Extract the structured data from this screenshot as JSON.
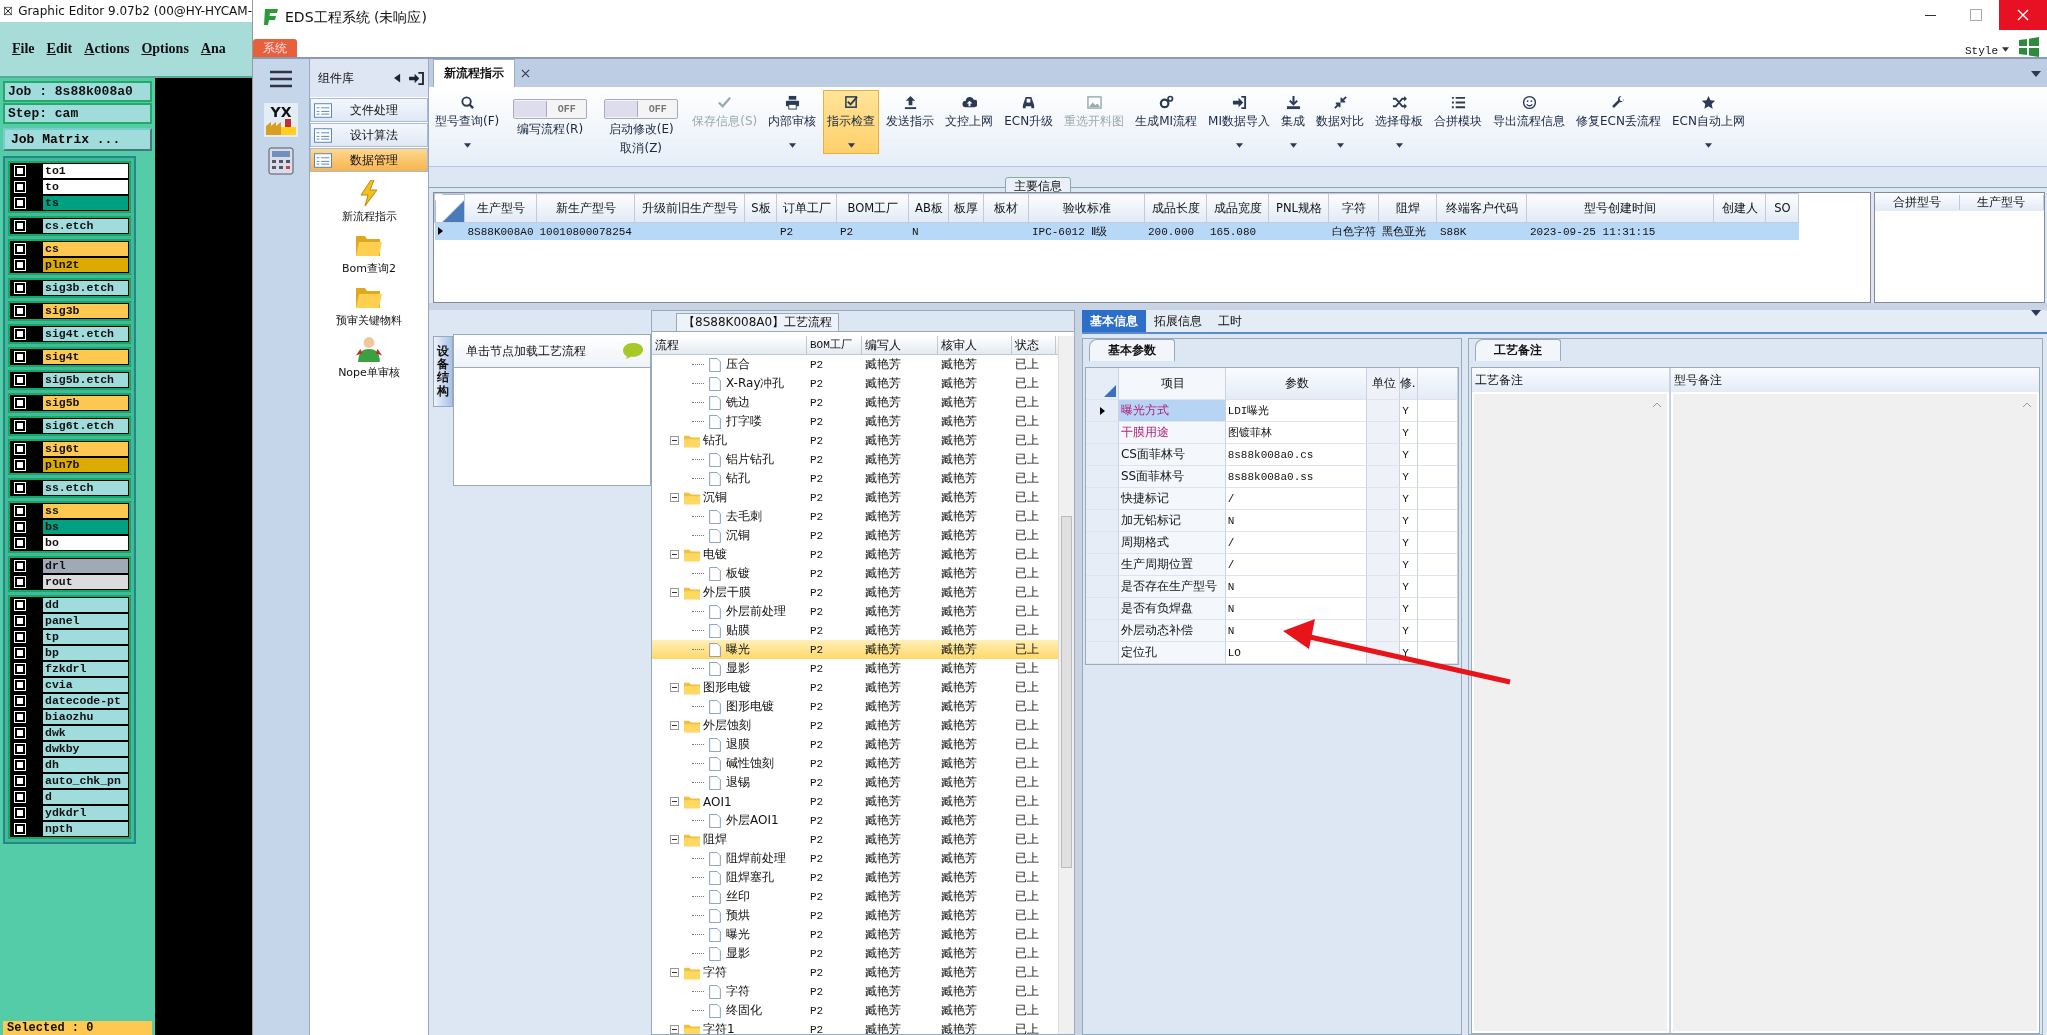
{
  "graphic_editor": {
    "title": "Graphic Editor 9.07b2 (00@HY-HYCAM-",
    "menu": [
      "File",
      "Edit",
      "Actions",
      "Options",
      "Ana"
    ],
    "job": "Job : 8s88k008a0",
    "step": "Step: cam",
    "matrix_button": "Job Matrix ...",
    "layer_groups": [
      [
        {
          "name": "to1",
          "color": "#ffffff",
          "checked": false
        },
        {
          "name": "to",
          "color": "#ffffff",
          "checked": false
        },
        {
          "name": "ts",
          "color": "#00a080",
          "checked": false
        }
      ],
      [
        {
          "name": "cs.etch",
          "color": "#a0dcdc",
          "checked": false
        }
      ],
      [
        {
          "name": "cs",
          "color": "#ffc850",
          "checked": false
        },
        {
          "name": "pln2t",
          "color": "#dcaa00",
          "checked": false
        }
      ],
      [
        {
          "name": "sig3b.etch",
          "color": "#a0dcdc",
          "checked": false
        }
      ],
      [
        {
          "name": "sig3b",
          "color": "#ffc850",
          "checked": false
        }
      ],
      [
        {
          "name": "sig4t.etch",
          "color": "#a0dcdc",
          "checked": false
        }
      ],
      [
        {
          "name": "sig4t",
          "color": "#ffc850",
          "checked": false
        }
      ],
      [
        {
          "name": "sig5b.etch",
          "color": "#a0dcdc",
          "checked": false
        }
      ],
      [
        {
          "name": "sig5b",
          "color": "#ffc850",
          "checked": false
        }
      ],
      [
        {
          "name": "sig6t.etch",
          "color": "#a0dcdc",
          "checked": false
        }
      ],
      [
        {
          "name": "sig6t",
          "color": "#ffc850",
          "checked": false
        },
        {
          "name": "pln7b",
          "color": "#dcaa00",
          "checked": false
        }
      ],
      [
        {
          "name": "ss.etch",
          "color": "#a0dcdc",
          "checked": false
        }
      ],
      [
        {
          "name": "ss",
          "color": "#ffc850",
          "checked": false
        },
        {
          "name": "bs",
          "color": "#00a080",
          "checked": false
        },
        {
          "name": "bo",
          "color": "#ffffff",
          "checked": false
        }
      ],
      [
        {
          "name": "drl",
          "color": "#a0aab4",
          "checked": false
        },
        {
          "name": "rout",
          "color": "#dcdcdc",
          "checked": false
        }
      ],
      [
        {
          "name": "dd",
          "color": "#a0dcdc",
          "checked": false
        },
        {
          "name": "panel",
          "color": "#a0dcdc",
          "checked": false
        },
        {
          "name": "tp",
          "color": "#a0dcdc",
          "checked": false
        },
        {
          "name": "bp",
          "color": "#a0dcdc",
          "checked": false
        },
        {
          "name": "fzkdrl",
          "color": "#a0dcdc",
          "checked": false
        },
        {
          "name": "cvia",
          "color": "#a0dcdc",
          "checked": false
        },
        {
          "name": "datecode-pt",
          "color": "#a0dcdc",
          "checked": false
        },
        {
          "name": "biaozhu",
          "color": "#a0dcdc",
          "checked": false
        },
        {
          "name": "dwk",
          "color": "#a0dcdc",
          "checked": false
        },
        {
          "name": "dwkby",
          "color": "#a0dcdc",
          "checked": false
        },
        {
          "name": "dh",
          "color": "#a0dcdc",
          "checked": false
        },
        {
          "name": "auto_chk_pn",
          "color": "#a0dcdc",
          "checked": false
        },
        {
          "name": "d",
          "color": "#a0dcdc",
          "checked": false
        },
        {
          "name": "ydkdrl",
          "color": "#a0dcdc",
          "checked": false
        },
        {
          "name": "npth",
          "color": "#a0dcdc",
          "checked": false
        }
      ]
    ],
    "status": "Selected : 0"
  },
  "eds": {
    "title": "EDS工程系统 (未响应)",
    "ribbon_tab": "系统",
    "style_menu": "Style",
    "nav_logo_text": "YX",
    "component_library": {
      "title": "组件库",
      "items": [
        {
          "label": "文件处理",
          "selected": false
        },
        {
          "label": "设计算法",
          "selected": false
        },
        {
          "label": "数据管理",
          "selected": true
        }
      ],
      "tools": [
        "新流程指示",
        "Bom查询2",
        "预审关键物料",
        "Nope单审核"
      ]
    },
    "document_tab": "新流程指示",
    "toolbar": [
      {
        "kind": "button",
        "label": "型号查询(F)",
        "dropdown": true,
        "disabled": false,
        "selected": false
      },
      {
        "kind": "toggle",
        "label": "编写流程(R)",
        "switch_text": "OFF",
        "on": false
      },
      {
        "kind": "toggle",
        "label": "启动修改(E)",
        "label2": "取消(Z)",
        "switch_text": "OFF",
        "on": false
      },
      {
        "kind": "button",
        "label": "保存信息(S)",
        "dropdown": false,
        "disabled": true,
        "selected": false
      },
      {
        "kind": "button",
        "label": "内部审核",
        "dropdown": true,
        "disabled": false,
        "selected": false
      },
      {
        "kind": "button",
        "label": "指示检查",
        "dropdown": true,
        "disabled": false,
        "selected": true
      },
      {
        "kind": "button",
        "label": "发送指示",
        "dropdown": false,
        "disabled": false,
        "selected": false
      },
      {
        "kind": "button",
        "label": "文控上网",
        "dropdown": false,
        "disabled": false,
        "selected": false
      },
      {
        "kind": "button",
        "label": "ECN升级",
        "dropdown": false,
        "disabled": false,
        "selected": false
      },
      {
        "kind": "button",
        "label": "重选开料图",
        "dropdown": false,
        "disabled": true,
        "selected": false
      },
      {
        "kind": "button",
        "label": "生成MI流程",
        "dropdown": false,
        "disabled": false,
        "selected": false
      },
      {
        "kind": "button",
        "label": "MI数据导入",
        "dropdown": true,
        "disabled": false,
        "selected": false
      },
      {
        "kind": "button",
        "label": "集成",
        "dropdown": true,
        "disabled": false,
        "selected": false
      },
      {
        "kind": "button",
        "label": "数据对比",
        "dropdown": true,
        "disabled": false,
        "selected": false
      },
      {
        "kind": "button",
        "label": "选择母板",
        "dropdown": true,
        "disabled": false,
        "selected": false
      },
      {
        "kind": "button",
        "label": "合拼模块",
        "dropdown": false,
        "disabled": false,
        "selected": false
      },
      {
        "kind": "button",
        "label": "导出流程信息",
        "dropdown": false,
        "disabled": false,
        "selected": false
      },
      {
        "kind": "button",
        "label": "修复ECN丢流程",
        "dropdown": false,
        "disabled": false,
        "selected": false
      },
      {
        "kind": "button",
        "label": "ECN自动上网",
        "dropdown": true,
        "disabled": false,
        "selected": false
      }
    ],
    "main_info": {
      "title": "主要信息",
      "columns": [
        "生产型号",
        "新生产型号",
        "升级前旧生产型号",
        "S板",
        "订单工厂",
        "BOM工厂",
        "AB板",
        "板厚",
        "板材",
        "验收标准",
        "成品长度",
        "成品宽度",
        "PNL规格",
        "字符",
        "阻焊",
        "终端客户代码",
        "型号创建时间",
        "创建人",
        "SO"
      ],
      "rows": [
        {
          "selected": true,
          "cells": [
            "8S88K008A0",
            "10010800078254",
            null,
            null,
            "P2",
            "P2",
            "N",
            null,
            null,
            "IPC-6012 Ⅱ级",
            "200.000",
            "165.080",
            null,
            "白色字符",
            "黑色亚光",
            "S88K",
            "2023-09-25 11:31:15",
            null,
            null
          ]
        }
      ],
      "side_columns": [
        "合拼型号",
        "生产型号"
      ]
    },
    "side_tab": "设备结构",
    "flow_hint": "单击节点加载工艺流程",
    "tree": {
      "title": "【8S88K008A0】工艺流程",
      "columns": [
        "流程",
        "BOM工厂",
        "编写人",
        "核审人",
        "状态"
      ],
      "nodes": [
        {
          "kind": "continuation",
          "children": [
            {
              "kind": "file",
              "name": "压合",
              "bom": "P2",
              "writer": "臧艳芳",
              "checker": "臧艳芳",
              "status": "已上",
              "selected": false
            },
            {
              "kind": "file",
              "name": "X-Ray冲孔",
              "bom": "P2",
              "writer": "臧艳芳",
              "checker": "臧艳芳",
              "status": "已上",
              "selected": false
            },
            {
              "kind": "file",
              "name": "铣边",
              "bom": "P2",
              "writer": "臧艳芳",
              "checker": "臧艳芳",
              "status": "已上",
              "selected": false
            },
            {
              "kind": "file",
              "name": "打字喽",
              "bom": "P2",
              "writer": "臧艳芳",
              "checker": "臧艳芳",
              "status": "已上",
              "selected": false
            }
          ]
        },
        {
          "kind": "folder",
          "name": "钻孔",
          "bom": "P2",
          "writer": "臧艳芳",
          "checker": "臧艳芳",
          "status": "已上",
          "selected": false,
          "expanded": true,
          "children": [
            {
              "kind": "file",
              "name": "铝片钻孔",
              "bom": "P2",
              "writer": "臧艳芳",
              "checker": "臧艳芳",
              "status": "已上",
              "selected": false
            },
            {
              "kind": "file",
              "name": "钻孔",
              "bom": "P2",
              "writer": "臧艳芳",
              "checker": "臧艳芳",
              "status": "已上",
              "selected": false
            }
          ]
        },
        {
          "kind": "folder",
          "name": "沉铜",
          "bom": "P2",
          "writer": "臧艳芳",
          "checker": "臧艳芳",
          "status": "已上",
          "selected": false,
          "expanded": true,
          "children": [
            {
              "kind": "file",
              "name": "去毛刺",
              "bom": "P2",
              "writer": "臧艳芳",
              "checker": "臧艳芳",
              "status": "已上",
              "selected": false
            },
            {
              "kind": "file",
              "name": "沉铜",
              "bom": "P2",
              "writer": "臧艳芳",
              "checker": "臧艳芳",
              "status": "已上",
              "selected": false
            }
          ]
        },
        {
          "kind": "folder",
          "name": "电镀",
          "bom": "P2",
          "writer": "臧艳芳",
          "checker": "臧艳芳",
          "status": "已上",
          "selected": false,
          "expanded": true,
          "children": [
            {
              "kind": "file",
              "name": "板镀",
              "bom": "P2",
              "writer": "臧艳芳",
              "checker": "臧艳芳",
              "status": "已上",
              "selected": false
            }
          ]
        },
        {
          "kind": "folder",
          "name": "外层干膜",
          "bom": "P2",
          "writer": "臧艳芳",
          "checker": "臧艳芳",
          "status": "已上",
          "selected": false,
          "expanded": true,
          "children": [
            {
              "kind": "file",
              "name": "外层前处理",
              "bom": "P2",
              "writer": "臧艳芳",
              "checker": "臧艳芳",
              "status": "已上",
              "selected": false
            },
            {
              "kind": "file",
              "name": "贴膜",
              "bom": "P2",
              "writer": "臧艳芳",
              "checker": "臧艳芳",
              "status": "已上",
              "selected": false
            },
            {
              "kind": "file",
              "name": "曝光",
              "bom": "P2",
              "writer": "臧艳芳",
              "checker": "臧艳芳",
              "status": "已上",
              "selected": true
            },
            {
              "kind": "file",
              "name": "显影",
              "bom": "P2",
              "writer": "臧艳芳",
              "checker": "臧艳芳",
              "status": "已上",
              "selected": false
            }
          ]
        },
        {
          "kind": "folder",
          "name": "图形电镀",
          "bom": "P2",
          "writer": "臧艳芳",
          "checker": "臧艳芳",
          "status": "已上",
          "selected": false,
          "expanded": true,
          "children": [
            {
              "kind": "file",
              "name": "图形电镀",
              "bom": "P2",
              "writer": "臧艳芳",
              "checker": "臧艳芳",
              "status": "已上",
              "selected": false
            }
          ]
        },
        {
          "kind": "folder",
          "name": "外层蚀刻",
          "bom": "P2",
          "writer": "臧艳芳",
          "checker": "臧艳芳",
          "status": "已上",
          "selected": false,
          "expanded": true,
          "children": [
            {
              "kind": "file",
              "name": "退膜",
              "bom": "P2",
              "writer": "臧艳芳",
              "checker": "臧艳芳",
              "status": "已上",
              "selected": false
            },
            {
              "kind": "file",
              "name": "碱性蚀刻",
              "bom": "P2",
              "writer": "臧艳芳",
              "checker": "臧艳芳",
              "status": "已上",
              "selected": false
            },
            {
              "kind": "file",
              "name": "退锡",
              "bom": "P2",
              "writer": "臧艳芳",
              "checker": "臧艳芳",
              "status": "已上",
              "selected": false
            }
          ]
        },
        {
          "kind": "folder",
          "name": "AOI1",
          "bom": "P2",
          "writer": "臧艳芳",
          "checker": "臧艳芳",
          "status": "已上",
          "selected": false,
          "expanded": true,
          "children": [
            {
              "kind": "file",
              "name": "外层AOI1",
              "bom": "P2",
              "writer": "臧艳芳",
              "checker": "臧艳芳",
              "status": "已上",
              "selected": false
            }
          ]
        },
        {
          "kind": "folder",
          "name": "阻焊",
          "bom": "P2",
          "writer": "臧艳芳",
          "checker": "臧艳芳",
          "status": "已上",
          "selected": false,
          "expanded": true,
          "children": [
            {
              "kind": "file",
              "name": "阻焊前处理",
              "bom": "P2",
              "writer": "臧艳芳",
              "checker": "臧艳芳",
              "status": "已上",
              "selected": false
            },
            {
              "kind": "file",
              "name": "阻焊塞孔",
              "bom": "P2",
              "writer": "臧艳芳",
              "checker": "臧艳芳",
              "status": "已上",
              "selected": false
            },
            {
              "kind": "file",
              "name": "丝印",
              "bom": "P2",
              "writer": "臧艳芳",
              "checker": "臧艳芳",
              "status": "已上",
              "selected": false
            },
            {
              "kind": "file",
              "name": "预烘",
              "bom": "P2",
              "writer": "臧艳芳",
              "checker": "臧艳芳",
              "status": "已上",
              "selected": false
            },
            {
              "kind": "file",
              "name": "曝光",
              "bom": "P2",
              "writer": "臧艳芳",
              "checker": "臧艳芳",
              "status": "已上",
              "selected": false
            },
            {
              "kind": "file",
              "name": "显影",
              "bom": "P2",
              "writer": "臧艳芳",
              "checker": "臧艳芳",
              "status": "已上",
              "selected": false
            }
          ]
        },
        {
          "kind": "folder",
          "name": "字符",
          "bom": "P2",
          "writer": "臧艳芳",
          "checker": "臧艳芳",
          "status": "已上",
          "selected": false,
          "expanded": true,
          "children": [
            {
              "kind": "file",
              "name": "字符",
              "bom": "P2",
              "writer": "臧艳芳",
              "checker": "臧艳芳",
              "status": "已上",
              "selected": false
            },
            {
              "kind": "file",
              "name": "终固化",
              "bom": "P2",
              "writer": "臧艳芳",
              "checker": "臧艳芳",
              "status": "已上",
              "selected": false
            }
          ]
        },
        {
          "kind": "folder",
          "name": "字符1",
          "bom": "P2",
          "writer": "臧艳芳",
          "checker": "臧艳芳",
          "status": "已上",
          "selected": false,
          "expanded": true
        }
      ]
    },
    "info_tabs": [
      {
        "label": "基本信息",
        "selected": true
      },
      {
        "label": "拓展信息",
        "selected": false
      },
      {
        "label": "工时",
        "selected": false
      }
    ],
    "params": {
      "tab": "基本参数",
      "columns": [
        "项目",
        "参数",
        "单位",
        "修.."
      ],
      "rows": [
        {
          "item": "曝光方式",
          "value": "LDI曝光",
          "flag": "Y",
          "highlight": true,
          "selected": true
        },
        {
          "item": "干膜用途",
          "value": "图镀菲林",
          "flag": "Y",
          "highlight": true,
          "selected": false
        },
        {
          "item": "CS面菲林号",
          "value": "8s88k008a0.cs",
          "flag": "Y",
          "highlight": false,
          "selected": false
        },
        {
          "item": "SS面菲林号",
          "value": "8s88k008a0.ss",
          "flag": "Y",
          "highlight": false,
          "selected": false
        },
        {
          "item": "快捷标记",
          "value": "/",
          "flag": "Y",
          "highlight": false,
          "selected": false
        },
        {
          "item": "加无铅标记",
          "value": "N",
          "flag": "Y",
          "highlight": false,
          "selected": false
        },
        {
          "item": "周期格式",
          "value": "/",
          "flag": "Y",
          "highlight": false,
          "selected": false
        },
        {
          "item": "生产周期位置",
          "value": "/",
          "flag": "Y",
          "highlight": false,
          "selected": false
        },
        {
          "item": "是否存在生产型号",
          "value": "N",
          "flag": "Y",
          "highlight": false,
          "selected": false
        },
        {
          "item": "是否有负焊盘",
          "value": "N",
          "flag": "Y",
          "highlight": false,
          "selected": false
        },
        {
          "item": "外层动态补偿",
          "value": "N",
          "flag": "Y",
          "highlight": false,
          "selected": false
        },
        {
          "item": "定位孔",
          "value": "LO",
          "flag": "Y",
          "highlight": false,
          "selected": false
        }
      ]
    },
    "notes": {
      "tab": "工艺备注",
      "columns": [
        "工艺备注",
        "型号备注"
      ]
    }
  }
}
